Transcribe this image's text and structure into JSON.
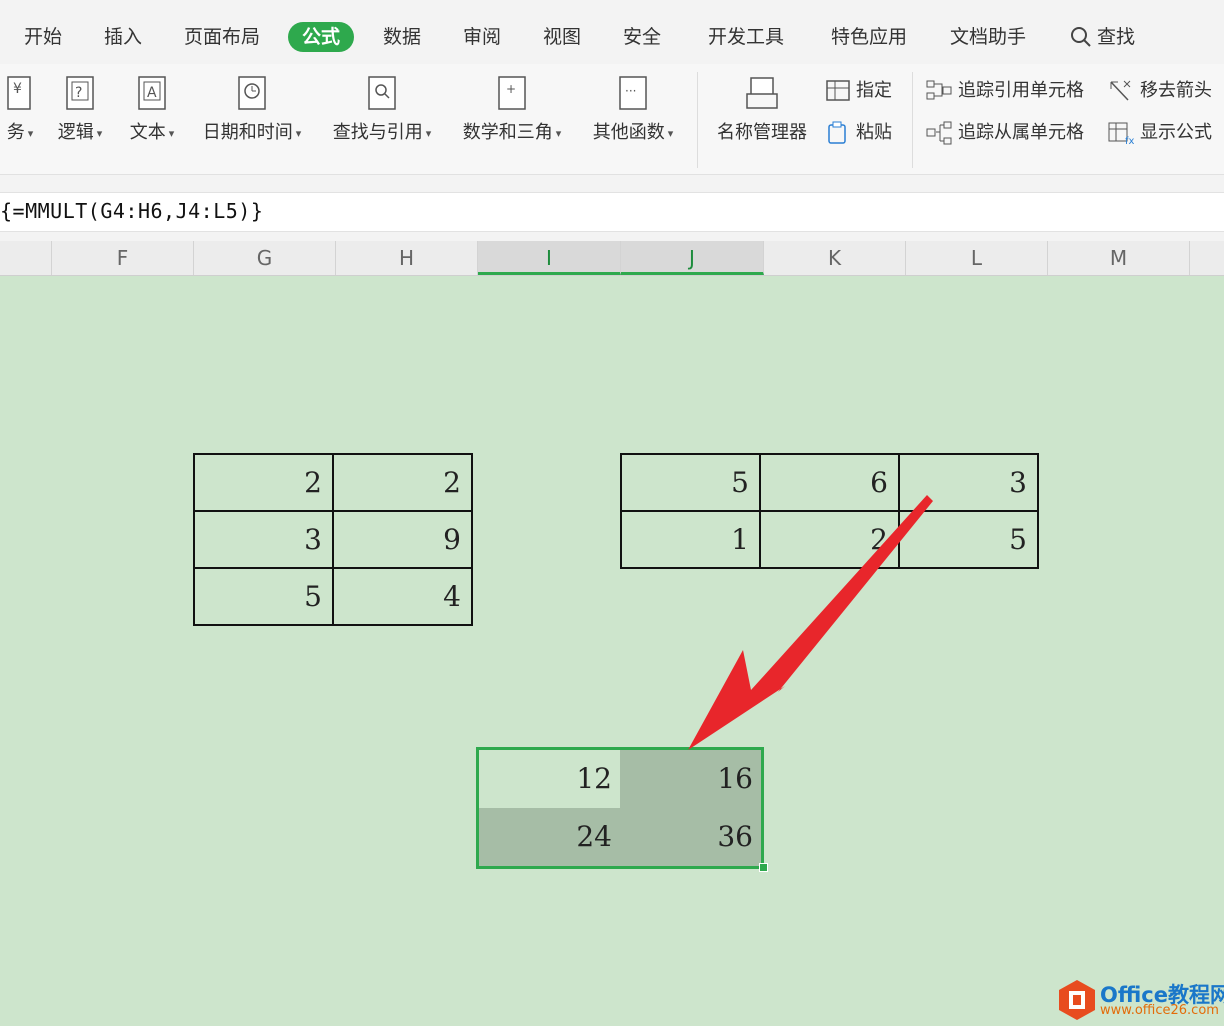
{
  "tabs": [
    "开始",
    "插入",
    "页面布局",
    "公式",
    "数据",
    "审阅",
    "视图",
    "安全",
    "开发工具",
    "特色应用",
    "文档助手",
    "查找"
  ],
  "ribbon": {
    "finance": "务",
    "logic": "逻辑",
    "text": "文本",
    "datetime": "日期和时间",
    "lookup": "查找与引用",
    "math": "数学和三角",
    "other": "其他函数",
    "name_manager": "名称管理器",
    "define": "指定",
    "paste": "粘贴",
    "trace_precedents": "追踪引用单元格",
    "trace_dependents": "追踪从属单元格",
    "remove_arrows": "移去箭头",
    "show_formulas": "显示公式"
  },
  "formula": "{=MMULT(G4:H6,J4:L5)}",
  "columns": [
    "F",
    "G",
    "H",
    "I",
    "J",
    "K",
    "L",
    "M"
  ],
  "matrixA": [
    [
      "2",
      "2"
    ],
    [
      "3",
      "9"
    ],
    [
      "5",
      "4"
    ]
  ],
  "matrixB": [
    [
      "5",
      "6",
      "3"
    ],
    [
      "1",
      "2",
      "5"
    ]
  ],
  "result": [
    [
      "12",
      "16"
    ],
    [
      "24",
      "36"
    ]
  ],
  "watermark": {
    "brand": "Office教程网",
    "url": "www.office26.com"
  },
  "colors": {
    "accent": "#2ea94d",
    "sheet": "#cde5cc",
    "arrow": "#e8262b"
  }
}
